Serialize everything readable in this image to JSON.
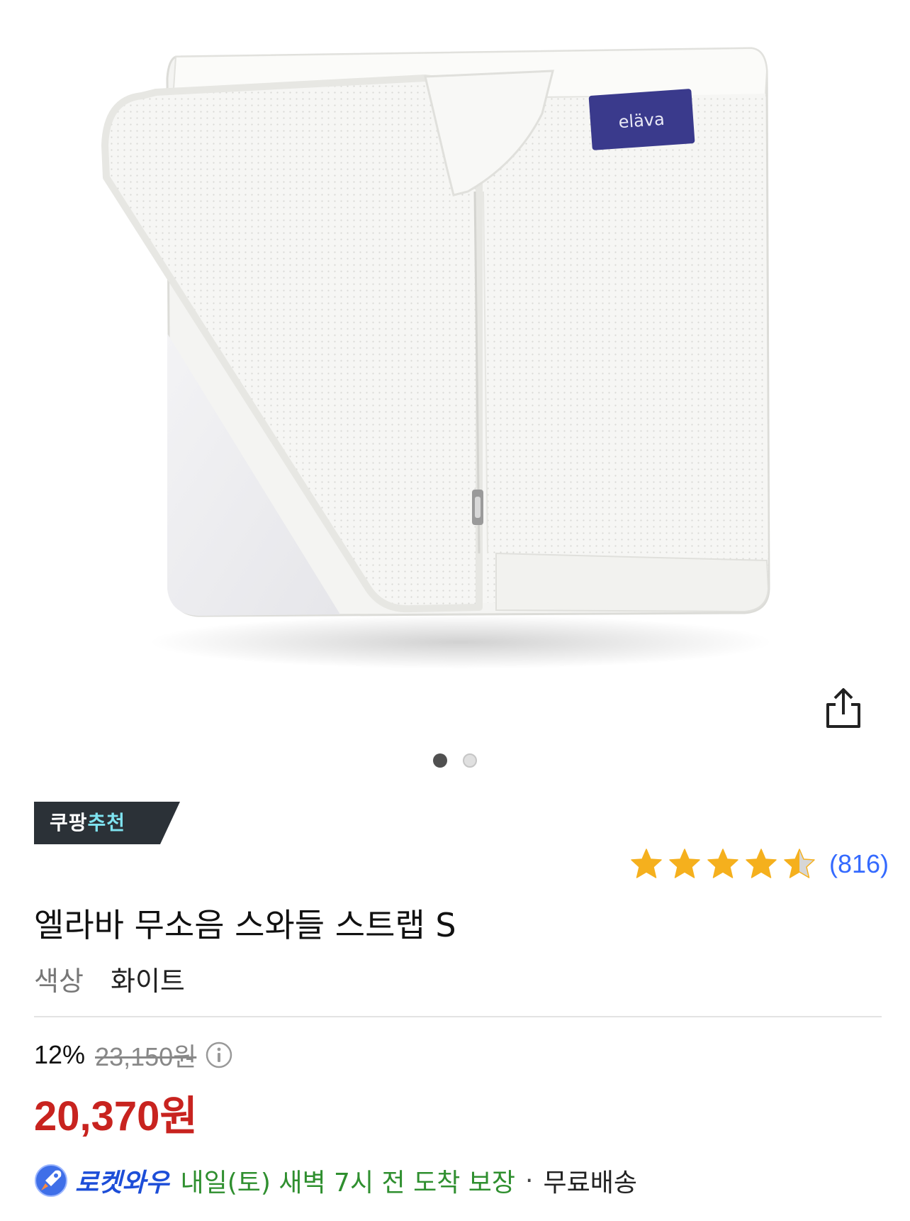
{
  "product_image": {
    "alt_brand_label": "eläva"
  },
  "carousel": {
    "total": 2,
    "active_index": 0
  },
  "badge": {
    "part1": "쿠팡",
    "part2": "추천"
  },
  "rating": {
    "stars": 4.5,
    "review_count": "(816)"
  },
  "product": {
    "title": "엘라바 무소음 스와들 스트랩 S"
  },
  "option": {
    "label": "색상",
    "value": "화이트"
  },
  "price": {
    "discount": "12%",
    "original": "23,150원",
    "sale": "20,370원"
  },
  "delivery": {
    "program": "로켓와우",
    "eta": "내일(토) 새벽 7시 전 도착 보장",
    "separator": "·",
    "shipping": "무료배송"
  },
  "colors": {
    "sale_price": "#c8231f",
    "review_link": "#346aff",
    "star": "#f5b01d",
    "delivery_green": "#2f8f2f",
    "badge_bg": "#2b3137",
    "badge_accent": "#7fe3f0"
  },
  "icons": [
    "share-icon",
    "info-icon",
    "rocket-icon",
    "star-icon"
  ]
}
